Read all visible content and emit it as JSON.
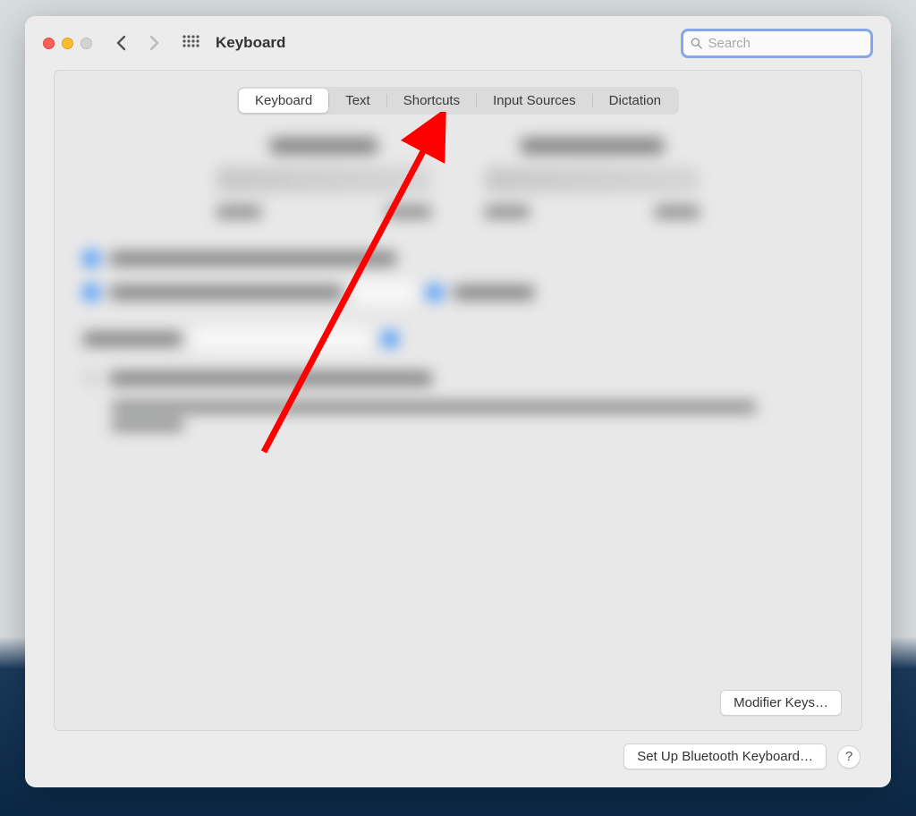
{
  "window": {
    "title": "Keyboard"
  },
  "toolbar": {
    "search_placeholder": "Search"
  },
  "tabs": [
    {
      "label": "Keyboard",
      "active": true
    },
    {
      "label": "Text",
      "active": false
    },
    {
      "label": "Shortcuts",
      "active": false
    },
    {
      "label": "Input Sources",
      "active": false
    },
    {
      "label": "Dictation",
      "active": false
    }
  ],
  "buttons": {
    "modifier_keys": "Modifier Keys…",
    "bluetooth_keyboard": "Set Up Bluetooth Keyboard…",
    "help": "?"
  },
  "annotation": {
    "color": "#ff0000"
  }
}
